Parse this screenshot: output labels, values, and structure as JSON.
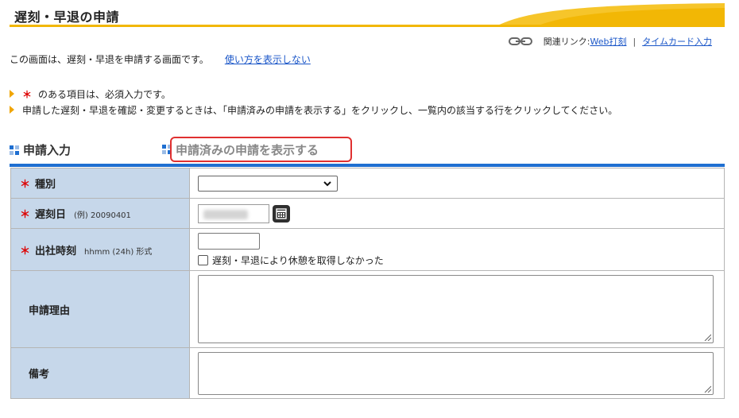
{
  "page": {
    "title": "遅刻・早退の申請",
    "accent_color": "#f2b705",
    "link_color": "#1a56c8"
  },
  "related": {
    "icon": "chain-link-icon",
    "label": "関連リンク:",
    "links": [
      "Web打刻",
      "タイムカード入力"
    ],
    "separator": "|"
  },
  "intro": {
    "text": "この画面は、遅刻・早退を申請する画面です。",
    "help_link": "使い方を表示しない"
  },
  "notes": {
    "required_mark": "＊",
    "required_text": "のある項目は、必須入力です。",
    "howto_text": "申請した遅刻・早退を確認・変更するときは、「申請済みの申請を表示する」をクリックし、一覧内の該当する行をクリックしてください。"
  },
  "tabs": {
    "input": "申請入力",
    "submitted": "申請済みの申請を表示する"
  },
  "form": {
    "required_mark": "＊",
    "type": {
      "label": "種別",
      "selected": ""
    },
    "date": {
      "label": "遅刻日",
      "hint": "(例) 20090401"
    },
    "time": {
      "label": "出社時刻",
      "hint": "hhmm (24h) 形式",
      "value": "",
      "checkbox_label": "遅刻・早退により休憩を取得しなかった"
    },
    "reason": {
      "label": "申請理由",
      "value": ""
    },
    "remarks": {
      "label": "備考",
      "value": ""
    }
  }
}
